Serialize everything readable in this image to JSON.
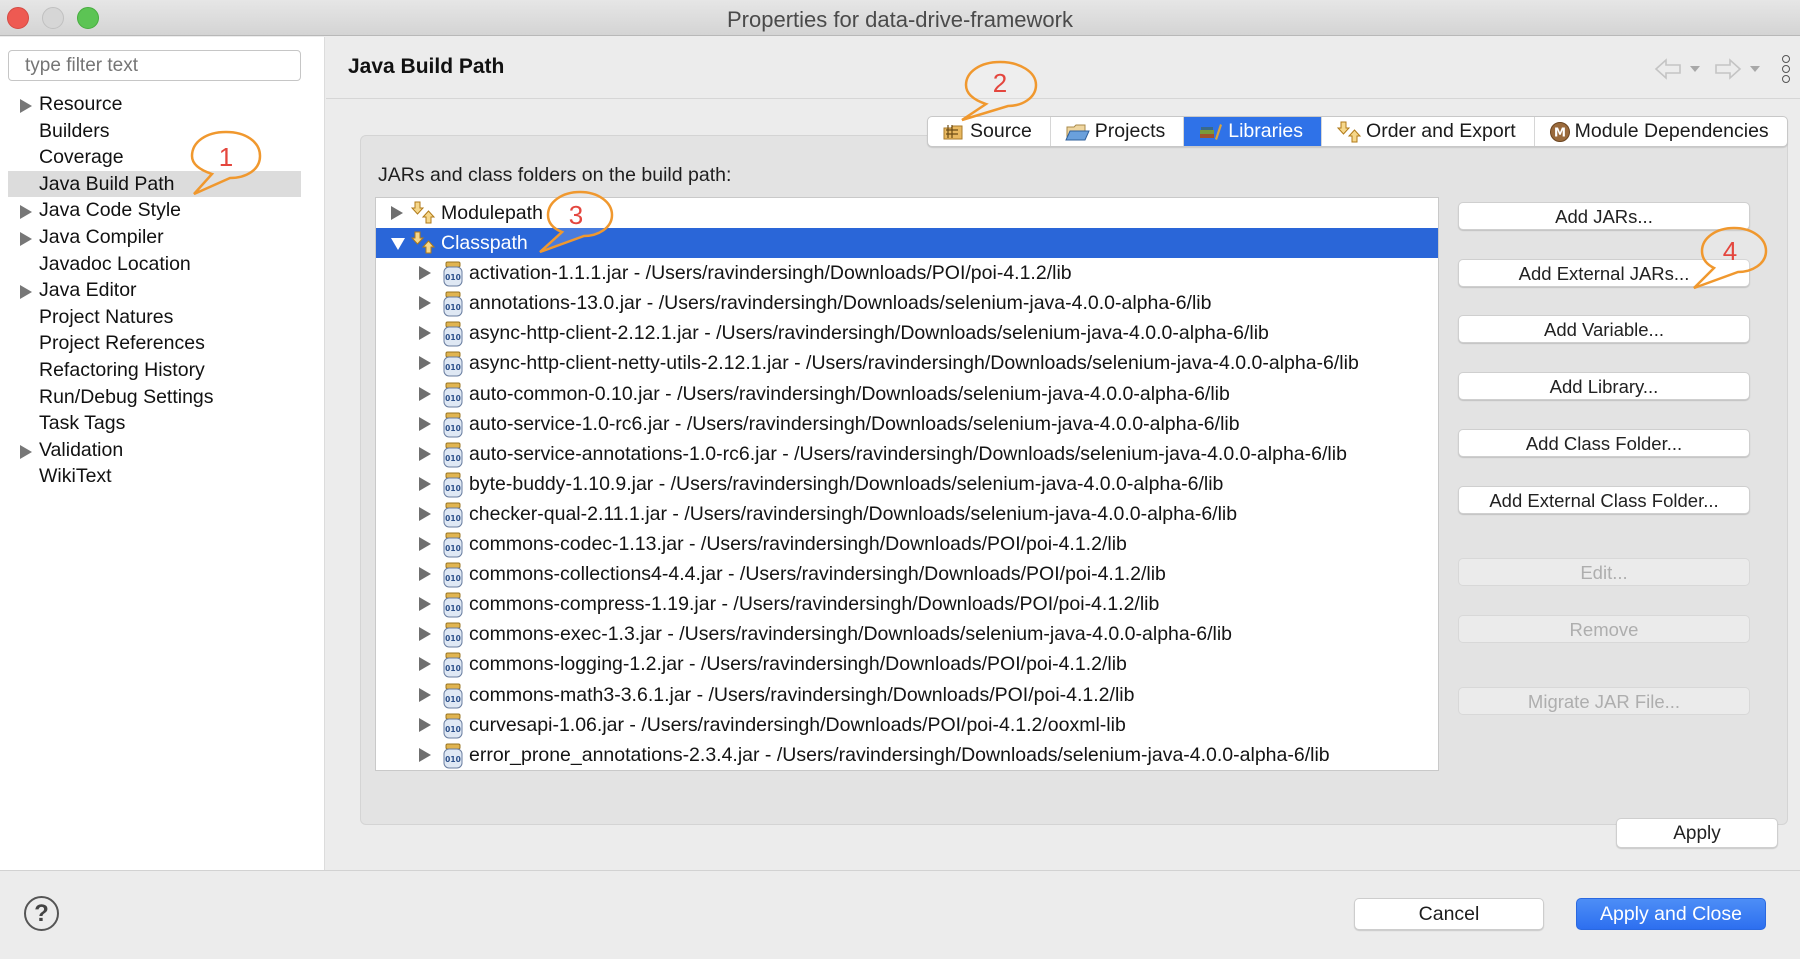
{
  "window": {
    "title": "Properties for data-drive-framework"
  },
  "sidebar": {
    "filter_placeholder": "type filter text",
    "items": [
      {
        "label": "Resource",
        "expandable": true,
        "selected": false
      },
      {
        "label": "Builders",
        "expandable": false,
        "selected": false
      },
      {
        "label": "Coverage",
        "expandable": false,
        "selected": false
      },
      {
        "label": "Java Build Path",
        "expandable": false,
        "selected": true
      },
      {
        "label": "Java Code Style",
        "expandable": true,
        "selected": false
      },
      {
        "label": "Java Compiler",
        "expandable": true,
        "selected": false
      },
      {
        "label": "Javadoc Location",
        "expandable": false,
        "selected": false
      },
      {
        "label": "Java Editor",
        "expandable": true,
        "selected": false
      },
      {
        "label": "Project Natures",
        "expandable": false,
        "selected": false
      },
      {
        "label": "Project References",
        "expandable": false,
        "selected": false
      },
      {
        "label": "Refactoring History",
        "expandable": false,
        "selected": false
      },
      {
        "label": "Run/Debug Settings",
        "expandable": false,
        "selected": false
      },
      {
        "label": "Task Tags",
        "expandable": false,
        "selected": false
      },
      {
        "label": "Validation",
        "expandable": true,
        "selected": false
      },
      {
        "label": "WikiText",
        "expandable": false,
        "selected": false
      }
    ]
  },
  "main": {
    "page_title": "Java Build Path",
    "tabs": [
      {
        "label": "Source",
        "icon": "source-folder-icon",
        "active": false
      },
      {
        "label": "Projects",
        "icon": "projects-folder-icon",
        "active": false
      },
      {
        "label": "Libraries",
        "icon": "libraries-icon",
        "active": true
      },
      {
        "label": "Order and Export",
        "icon": "order-export-icon",
        "active": false
      },
      {
        "label": "Module Dependencies",
        "icon": "module-icon",
        "active": false
      }
    ],
    "build_path_label": "JARs and class folders on the build path:",
    "tree": {
      "roots": [
        {
          "label": "Modulepath",
          "expanded": false,
          "selected": false
        },
        {
          "label": "Classpath",
          "expanded": true,
          "selected": true
        }
      ],
      "classpath_entries": [
        "activation-1.1.1.jar - /Users/ravindersingh/Downloads/POI/poi-4.1.2/lib",
        "annotations-13.0.jar - /Users/ravindersingh/Downloads/selenium-java-4.0.0-alpha-6/lib",
        "async-http-client-2.12.1.jar - /Users/ravindersingh/Downloads/selenium-java-4.0.0-alpha-6/lib",
        "async-http-client-netty-utils-2.12.1.jar - /Users/ravindersingh/Downloads/selenium-java-4.0.0-alpha-6/lib",
        "auto-common-0.10.jar - /Users/ravindersingh/Downloads/selenium-java-4.0.0-alpha-6/lib",
        "auto-service-1.0-rc6.jar - /Users/ravindersingh/Downloads/selenium-java-4.0.0-alpha-6/lib",
        "auto-service-annotations-1.0-rc6.jar - /Users/ravindersingh/Downloads/selenium-java-4.0.0-alpha-6/lib",
        "byte-buddy-1.10.9.jar - /Users/ravindersingh/Downloads/selenium-java-4.0.0-alpha-6/lib",
        "checker-qual-2.11.1.jar - /Users/ravindersingh/Downloads/selenium-java-4.0.0-alpha-6/lib",
        "commons-codec-1.13.jar - /Users/ravindersingh/Downloads/POI/poi-4.1.2/lib",
        "commons-collections4-4.4.jar - /Users/ravindersingh/Downloads/POI/poi-4.1.2/lib",
        "commons-compress-1.19.jar - /Users/ravindersingh/Downloads/POI/poi-4.1.2/lib",
        "commons-exec-1.3.jar - /Users/ravindersingh/Downloads/selenium-java-4.0.0-alpha-6/lib",
        "commons-logging-1.2.jar - /Users/ravindersingh/Downloads/POI/poi-4.1.2/lib",
        "commons-math3-3.6.1.jar - /Users/ravindersingh/Downloads/POI/poi-4.1.2/lib",
        "curvesapi-1.06.jar - /Users/ravindersingh/Downloads/POI/poi-4.1.2/ooxml-lib",
        "error_prone_annotations-2.3.4.jar - /Users/ravindersingh/Downloads/selenium-java-4.0.0-alpha-6/lib"
      ]
    },
    "buttons": [
      {
        "label": "Add JARs...",
        "enabled": true
      },
      {
        "label": "Add External JARs...",
        "enabled": true
      },
      {
        "label": "Add Variable...",
        "enabled": true
      },
      {
        "label": "Add Library...",
        "enabled": true
      },
      {
        "label": "Add Class Folder...",
        "enabled": true
      },
      {
        "label": "Add External Class Folder...",
        "enabled": true
      },
      {
        "label": "Edit...",
        "enabled": false
      },
      {
        "label": "Remove",
        "enabled": false
      },
      {
        "label": "Migrate JAR File...",
        "enabled": false
      }
    ],
    "apply_label": "Apply"
  },
  "footer": {
    "help_label": "?",
    "cancel_label": "Cancel",
    "apply_close_label": "Apply and Close"
  },
  "callouts": [
    "1",
    "2",
    "3",
    "4"
  ],
  "colors": {
    "accent": "#2f72e8",
    "selection": "#2a66d8",
    "callout_stroke": "#f0982e",
    "callout_text": "#e4463e"
  }
}
